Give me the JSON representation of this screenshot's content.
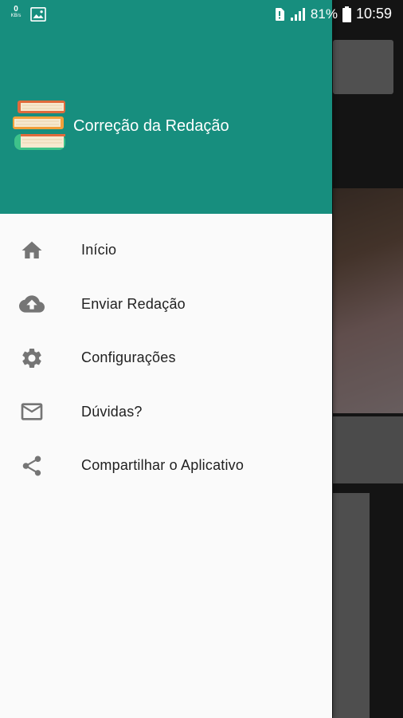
{
  "status_bar": {
    "net_speed_value": "0",
    "net_speed_unit": "KB/s",
    "battery_percent": "81%",
    "time": "10:59",
    "icons": [
      "image-icon",
      "sim-alert-icon",
      "signal-icon",
      "battery-icon"
    ]
  },
  "drawer": {
    "header": {
      "title": "Correção da Redação",
      "logo_icon": "books-icon",
      "background_color": "#178e7e"
    },
    "items": [
      {
        "label": "Início",
        "icon": "home-icon"
      },
      {
        "label": "Enviar Redação",
        "icon": "cloud-upload-icon"
      },
      {
        "label": "Configurações",
        "icon": "gear-icon"
      },
      {
        "label": "Dúvidas?",
        "icon": "mail-icon"
      },
      {
        "label": "Compartilhar o Aplicativo",
        "icon": "share-icon"
      }
    ]
  }
}
